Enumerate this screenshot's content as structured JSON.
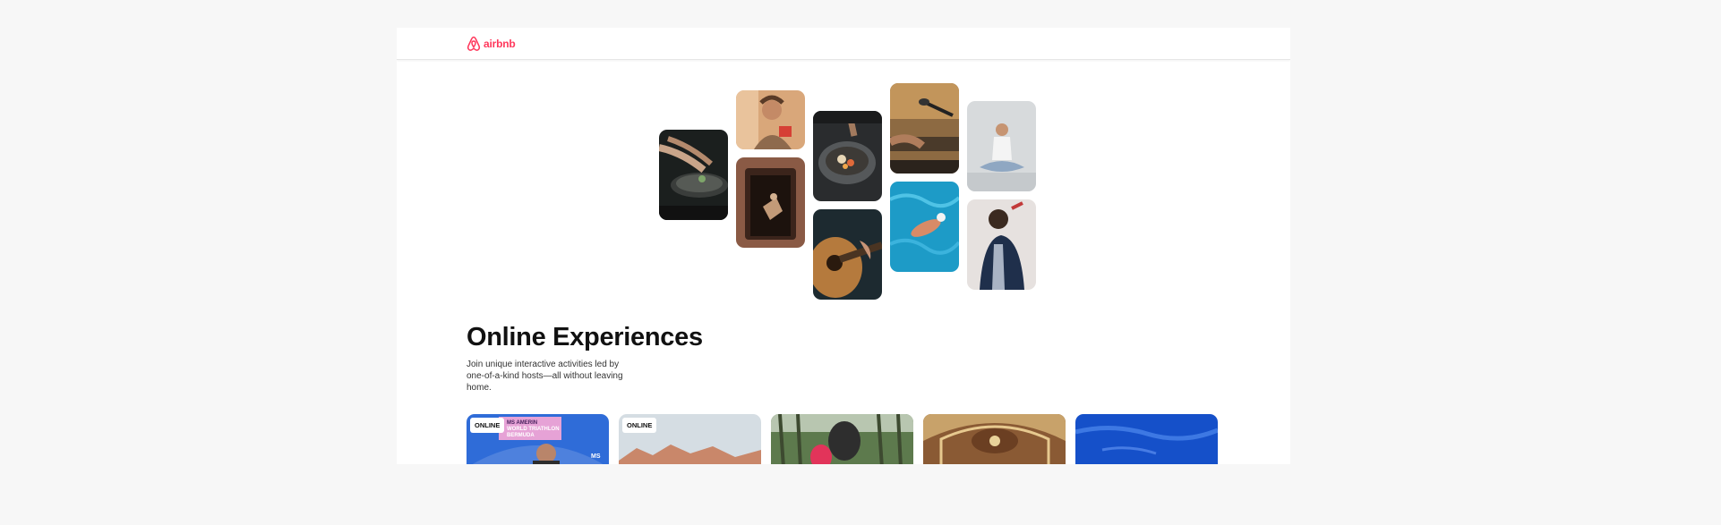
{
  "header": {
    "logo_text": "airbnb",
    "logo_icon": "airbnb-belo-icon",
    "brand_color": "#ff385c"
  },
  "hero": {
    "title": "Online Experiences",
    "subtitle": "Join unique interactive activities led by one-of-a-kind hosts—all without leaving home."
  },
  "collage": [
    {
      "subject": "cooking-pan"
    },
    {
      "subject": "woman-with-product"
    },
    {
      "subject": "performer-in-doorway"
    },
    {
      "subject": "food-bowl"
    },
    {
      "subject": "guitar-player"
    },
    {
      "subject": "drum-microphone"
    },
    {
      "subject": "swimmer-in-pool"
    },
    {
      "subject": "meditation-yoga"
    },
    {
      "subject": "singer-with-microphone"
    }
  ],
  "cards": [
    {
      "badge": "ONLINE",
      "sign_text": [
        "MS AMERIN",
        "WORLD TRIATHLON",
        "BERMUDA"
      ],
      "corner_text": "MS"
    },
    {
      "badge": "ONLINE"
    },
    {
      "badge": ""
    },
    {
      "badge": ""
    },
    {
      "badge": ""
    }
  ]
}
